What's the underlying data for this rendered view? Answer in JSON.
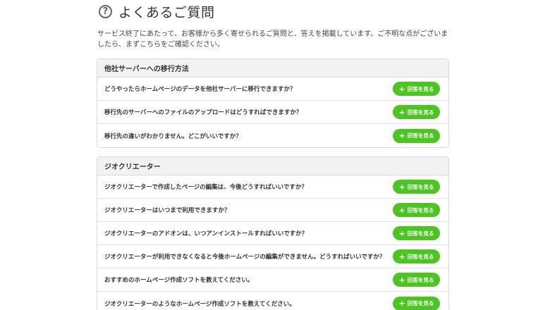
{
  "header": {
    "icon": "question-circle-icon",
    "title": "よくあるご質問"
  },
  "intro": {
    "text": "サービス終了にあたって、お客様から多く寄せられるご質問と、答えを掲載しています。ご不明な点がございましたら、まずこちらをご確認ください。"
  },
  "colors": {
    "accent_green": "#4cc422",
    "section_header_bg": "#f2f2f2",
    "border": "#d9d9d9"
  },
  "sections": [
    {
      "title": "他社サーバーへの移行方法",
      "items": [
        {
          "question": "どうやったらホームページのデータを他社サーバーに移行できますか？",
          "button_icon": "plus-icon",
          "button_label": "回答を見る"
        },
        {
          "question": "移行先のサーバーへのファイルのアップロードはどうすればできますか？",
          "button_icon": "plus-icon",
          "button_label": "回答を見る"
        },
        {
          "question": "移行先の違いがわかりません。どこがいいですか？",
          "button_icon": "plus-icon",
          "button_label": "回答を見る"
        }
      ]
    },
    {
      "title": "ジオクリエーター",
      "items": [
        {
          "question": "ジオクリエーターで作成したページの編集は、今後どうすればいいですか？",
          "button_icon": "plus-icon",
          "button_label": "回答を見る"
        },
        {
          "question": "ジオクリエーターはいつまで利用できますか？",
          "button_icon": "plus-icon",
          "button_label": "回答を見る"
        },
        {
          "question": "ジオクリエーターのアドオンは、いつアンインストールすればいいですか？",
          "button_icon": "plus-icon",
          "button_label": "回答を見る"
        },
        {
          "question": "ジオクリエーターが利用できなくなると今後ホームページの編集ができません。どうすればいいですか？",
          "button_icon": "plus-icon",
          "button_label": "回答を見る"
        },
        {
          "question": "おすすめのホームページ作成ソフトを教えてください。",
          "button_icon": "plus-icon",
          "button_label": "回答を見る"
        },
        {
          "question": "ジオクリエーターのようなホームページ作成ソフトを教えてください。",
          "button_icon": "plus-icon",
          "button_label": "回答を見る"
        }
      ]
    }
  ]
}
